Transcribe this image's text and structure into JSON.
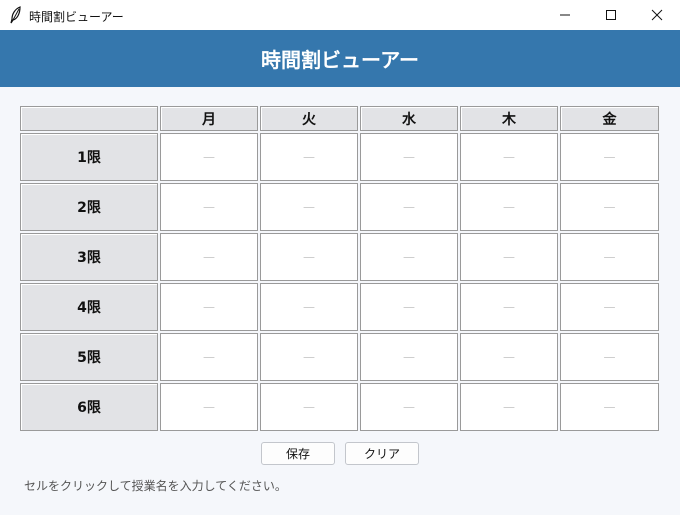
{
  "window": {
    "title": "時間割ビューアー",
    "app_icon": "feather-icon",
    "controls": [
      "minimize-icon",
      "maximize-icon",
      "close-icon"
    ]
  },
  "header": {
    "title": "時間割ビューアー",
    "bg_color": "#3577ad"
  },
  "timetable": {
    "days": [
      "月",
      "火",
      "水",
      "木",
      "金"
    ],
    "periods": [
      "1限",
      "2限",
      "3限",
      "4限",
      "5限",
      "6限"
    ],
    "cells": [
      [
        "—",
        "—",
        "—",
        "—",
        "—"
      ],
      [
        "—",
        "—",
        "—",
        "—",
        "—"
      ],
      [
        "—",
        "—",
        "—",
        "—",
        "—"
      ],
      [
        "—",
        "—",
        "—",
        "—",
        "—"
      ],
      [
        "—",
        "—",
        "—",
        "—",
        "—"
      ],
      [
        "—",
        "—",
        "—",
        "—",
        "—"
      ]
    ]
  },
  "actions": {
    "save_label": "保存",
    "clear_label": "クリア"
  },
  "hint": "セルをクリックして授業名を入力してください。"
}
